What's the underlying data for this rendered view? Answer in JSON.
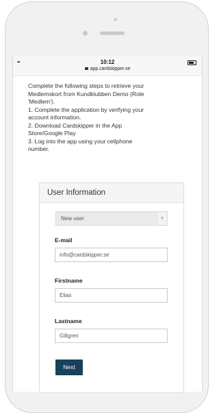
{
  "statusbar": {
    "signal": "▪▪▪",
    "time": "10:12",
    "url": "app.cardskipper.se"
  },
  "intro": {
    "lines": [
      "Complete the following steps to retrieve your",
      "Medlemskort from Kundklubben Demo (Role",
      "'Medlem').",
      "1. Complete the application by verifying your",
      "account information.",
      "2. Download Cardskipper in the App",
      "Store/Google Play",
      "3. Log into the app using your cellphone",
      "number."
    ]
  },
  "panel": {
    "title": "User Information",
    "select_value": "New user",
    "email_label": "E-mail",
    "email_value": "info@cardskipper.se",
    "firstname_label": "Firstname",
    "firstname_value": "Elias",
    "lastname_label": "Lastname",
    "lastname_value": "Gillgren",
    "next_label": "Next"
  },
  "colors": {
    "button": "#17425a"
  },
  "icons": {
    "lock": "lock-icon",
    "dropdown": "chevron-down-icon",
    "battery": "battery-icon",
    "signal": "signal-icon"
  }
}
